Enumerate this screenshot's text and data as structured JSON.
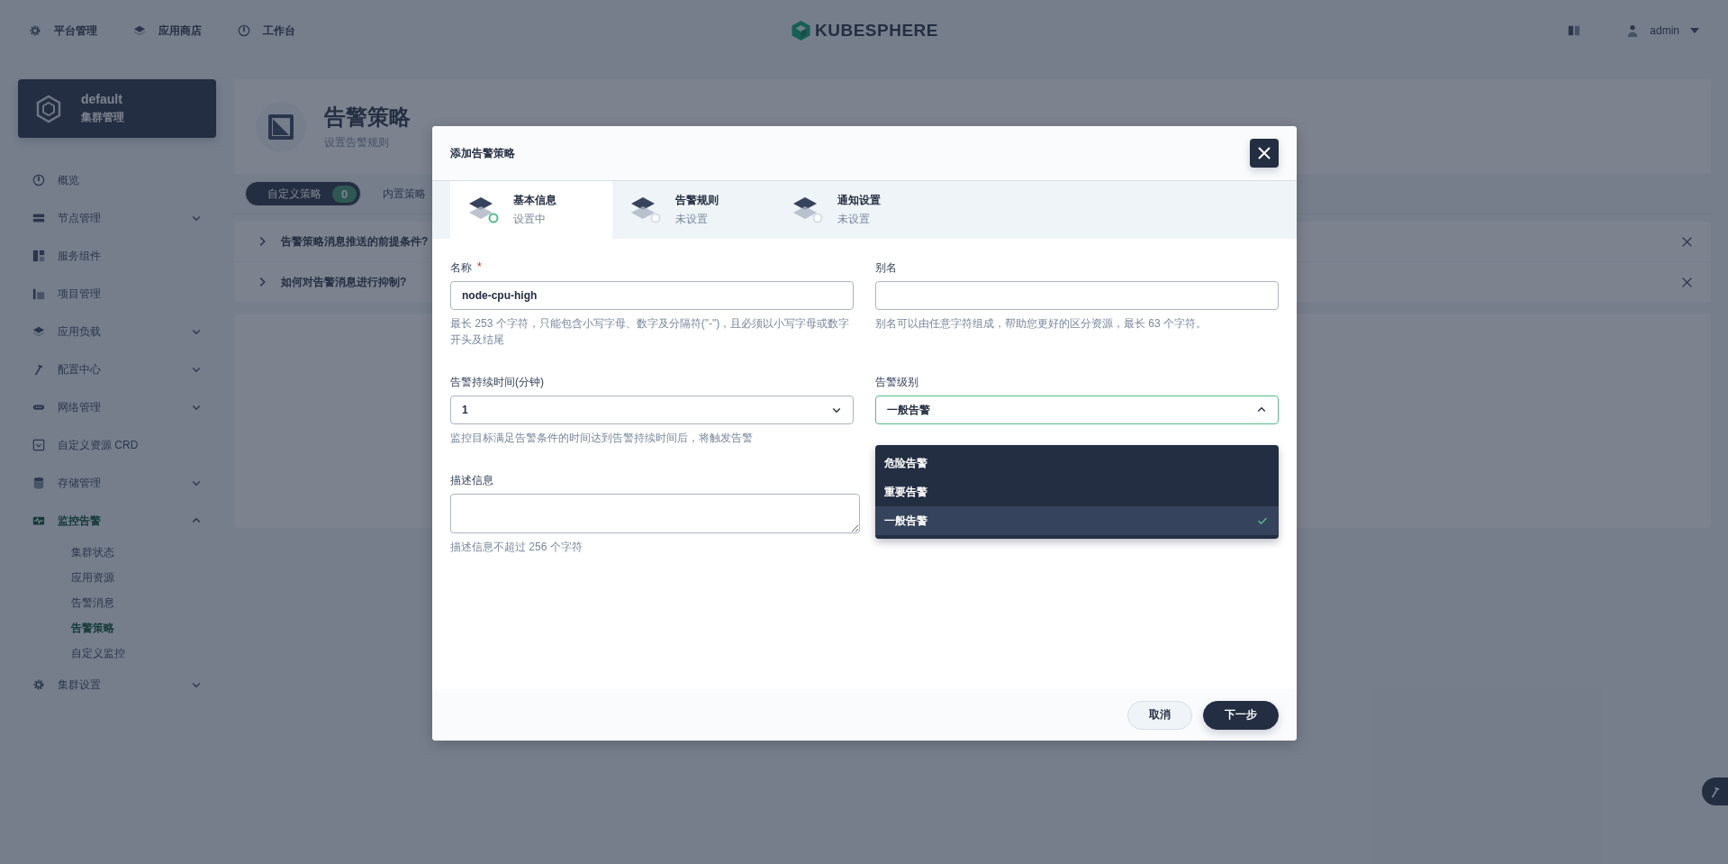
{
  "topbar": {
    "nav": [
      {
        "label": "平台管理"
      },
      {
        "label": "应用商店"
      },
      {
        "label": "工作台"
      }
    ],
    "logo": "KUBESPHERE",
    "user": "admin"
  },
  "sidebar": {
    "cluster": {
      "name": "default",
      "subtitle": "集群管理"
    },
    "items": [
      {
        "label": "概览",
        "selected": false
      },
      {
        "label": "节点管理",
        "expanded": false,
        "selected": false
      },
      {
        "label": "服务组件",
        "selected": false
      },
      {
        "label": "项目管理",
        "selected": false
      },
      {
        "label": "应用负载",
        "expanded": false,
        "selected": false
      },
      {
        "label": "配置中心",
        "expanded": false,
        "selected": false
      },
      {
        "label": "网络管理",
        "expanded": false,
        "selected": false
      },
      {
        "label": "自定义资源 CRD",
        "selected": false
      },
      {
        "label": "存储管理",
        "expanded": false,
        "selected": false
      },
      {
        "label": "监控告警",
        "expanded": true,
        "selected": true,
        "children": [
          {
            "label": "集群状态",
            "selected": false
          },
          {
            "label": "应用资源",
            "selected": false
          },
          {
            "label": "告警消息",
            "selected": false
          },
          {
            "label": "告警策略",
            "selected": true
          },
          {
            "label": "自定义监控",
            "selected": false
          }
        ]
      },
      {
        "label": "集群设置",
        "expanded": false,
        "selected": false
      }
    ]
  },
  "page": {
    "title": "告警策略",
    "subtitle": "设置告警规则",
    "tabs": [
      {
        "label": "自定义策略",
        "count": "0",
        "selected": true
      },
      {
        "label": "内置策略",
        "selected": false
      }
    ],
    "tips": [
      {
        "text": "告警策略消息推送的前提条件?"
      },
      {
        "text": "如何对告警消息进行抑制?"
      }
    ]
  },
  "modal": {
    "title": "添加告警策略",
    "steps": [
      {
        "title": "基本信息",
        "status": "设置中",
        "selected": true
      },
      {
        "title": "告警规则",
        "status": "未设置",
        "selected": false
      },
      {
        "title": "通知设置",
        "status": "未设置",
        "selected": false
      }
    ],
    "fields": [
      {
        "kind": "input",
        "label": "名称",
        "required_mark": "*",
        "value": "node-cpu-high",
        "hint": "最长 253 个字符，只能包含小写字母、数字及分隔符(\"-\")，且必须以小写字母或数字开头及结尾"
      },
      {
        "kind": "input",
        "label": "别名",
        "hint": "别名可以由任意字符组成，帮助您更好的区分资源，最长 63 个字符。"
      },
      {
        "kind": "select",
        "label": "告警持续时间(分钟)",
        "value": "1",
        "open": false,
        "hint": "监控目标满足告警条件的时间达到告警持续时间后，将触发告警"
      },
      {
        "kind": "select",
        "label": "告警级别",
        "value": "一般告警",
        "open": true,
        "options": [
          {
            "label": "危险告警",
            "selected": false
          },
          {
            "label": "重要告警",
            "selected": false
          },
          {
            "label": "一般告警",
            "selected": true
          }
        ]
      },
      {
        "kind": "textarea",
        "label": "描述信息",
        "hint": "描述信息不超过 256 个字符"
      }
    ],
    "buttons": [
      {
        "label": "取消",
        "kind": "secondary"
      },
      {
        "label": "下一步",
        "kind": "primary"
      }
    ]
  }
}
